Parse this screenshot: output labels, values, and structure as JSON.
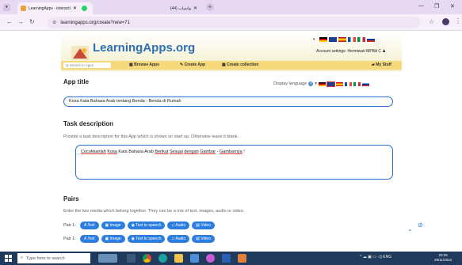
{
  "browser": {
    "tabs": [
      {
        "title": "LearningApps - interactive and",
        "active": true
      },
      {
        "title": "(44) واتساب",
        "active": false
      }
    ],
    "url": "learningapps.org/create?new=71"
  },
  "header": {
    "logo": "LearningApps.org",
    "account": "Account settings: Hermiwati MPBA C",
    "search_placeholder": "Q Search in Apps",
    "nav": [
      "Browse Apps",
      "Create App",
      "Create collection"
    ],
    "mystuff": "My Stuff"
  },
  "app_title": {
    "heading": "App title",
    "display_language": "Display language",
    "value": "Kosa Kata Bahasa Arab tentang Benda - Benda di Rumah"
  },
  "task": {
    "heading": "Task description",
    "hint": "Provide a task description for this App which is shown on start up. Otherwise leave it blank.",
    "words": [
      "Cocokkanlah",
      "Kosa",
      "Kata",
      "Bahasa",
      "Arab",
      "Berikut",
      "Sesuai",
      "dengan",
      "Gambar",
      "-",
      "Gambarnya",
      "!"
    ],
    "underlined": [
      true,
      true,
      false,
      false,
      false,
      true,
      true,
      true,
      true,
      false,
      true,
      false
    ]
  },
  "pairs": {
    "heading": "Pairs",
    "hint": "Enter the two media which belong together. They can be a mix of text, images, audio or video.",
    "rows": [
      {
        "label": "Pair 1:",
        "buttons": [
          "A Text",
          "Image",
          "Text to speech",
          "Audio",
          "Video"
        ]
      },
      {
        "label": "Pair 1:",
        "buttons": [
          "A Text",
          "Image",
          "Text to speech",
          "Audio",
          "Video"
        ]
      }
    ]
  },
  "taskbar": {
    "search_placeholder": "Type here to search",
    "lang": "ENG",
    "time": "20:35",
    "date": "29/11/2024"
  },
  "colors": {
    "accent": "#2b7de0",
    "navbar": "#f5d97a",
    "taskbar": "#1f3a5a",
    "logo": "#2c6fb4"
  }
}
